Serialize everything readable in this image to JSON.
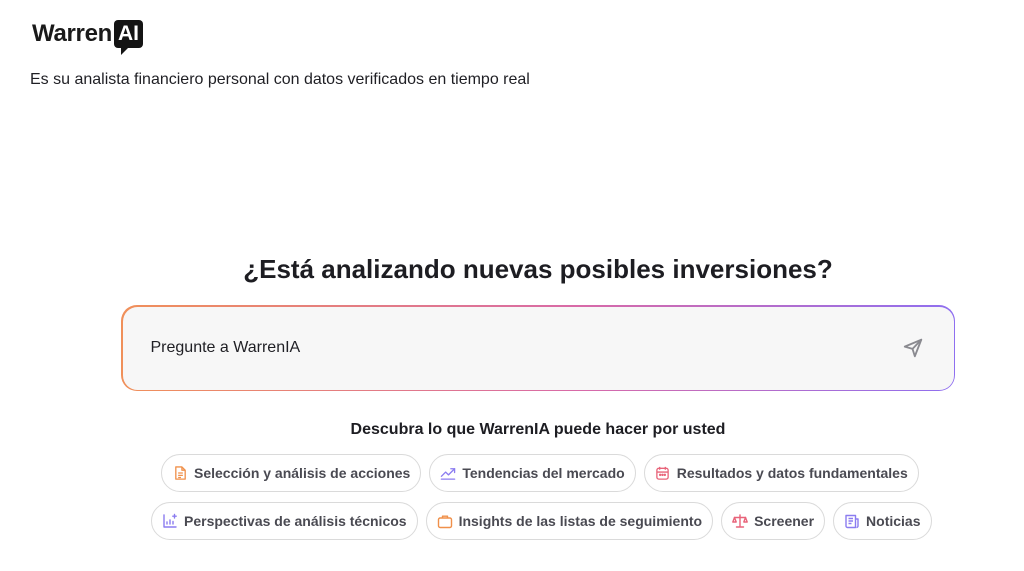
{
  "logo": {
    "word": "Warren",
    "badge": "AI"
  },
  "tagline": "Es su analista financiero personal con datos verificados en tiempo real",
  "headline": "¿Está analizando nuevas posibles inversiones?",
  "prompt": {
    "placeholder": "Pregunte a WarrenIA",
    "send_icon": "send-icon"
  },
  "discover_title": "Descubra lo que WarrenIA puede hacer por usted",
  "chips_row1": [
    {
      "label": "Selección y análisis de acciones",
      "icon": "document-icon",
      "color": "#f0904a"
    },
    {
      "label": "Tendencias del mercado",
      "icon": "trend-line-icon",
      "color": "#8b7cf0"
    },
    {
      "label": "Resultados y datos fundamentales",
      "icon": "calendar-icon",
      "color": "#e8647a"
    }
  ],
  "chips_row2": [
    {
      "label": "Perspectivas de análisis técnicos",
      "icon": "chart-sparkle-icon",
      "color": "#8b7cf0"
    },
    {
      "label": "Insights de las listas de seguimiento",
      "icon": "briefcase-icon",
      "color": "#f0904a"
    },
    {
      "label": "Screener",
      "icon": "scale-icon",
      "color": "#e8647a"
    },
    {
      "label": "Noticias",
      "icon": "newspaper-icon",
      "color": "#8b7cf0"
    }
  ]
}
